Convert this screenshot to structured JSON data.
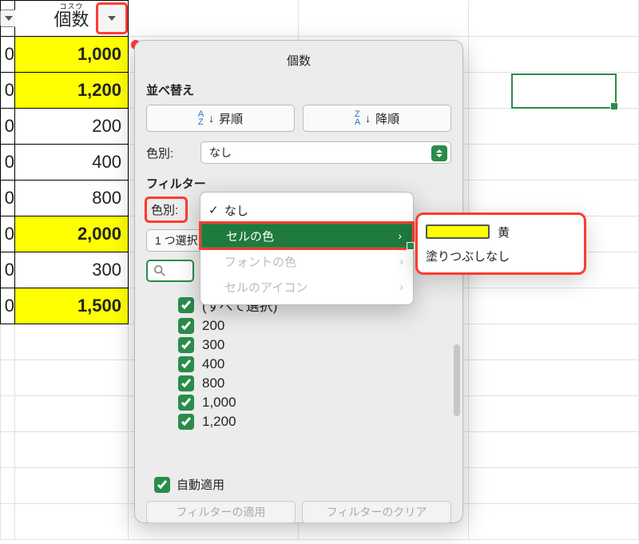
{
  "header": {
    "ruby": "コスウ",
    "label": "個数"
  },
  "rows": [
    {
      "v": "1,000",
      "hl": true
    },
    {
      "v": "1,200",
      "hl": true
    },
    {
      "v": "200",
      "hl": false
    },
    {
      "v": "400",
      "hl": false
    },
    {
      "v": "800",
      "hl": false
    },
    {
      "v": "2,000",
      "hl": true
    },
    {
      "v": "300",
      "hl": false
    },
    {
      "v": "1,500",
      "hl": true
    }
  ],
  "popover": {
    "title": "個数",
    "sort_label": "並べ替え",
    "asc_label": "昇順",
    "desc_label": "降順",
    "color_label": "色別:",
    "color_value": "なし",
    "filter_label": "フィルター",
    "filter_color_label": "色別:",
    "choose_one_label": "1 つ選択",
    "search_placeholder": "検索",
    "items": [
      "(すべて選択)",
      "200",
      "300",
      "400",
      "800",
      "1,000",
      "1,200"
    ],
    "autoapply_label": "自動適用",
    "apply_btn": "フィルターの適用",
    "clear_btn": "フィルターのクリア"
  },
  "ctx": {
    "none": "なし",
    "cell_color": "セルの色",
    "font_color": "フォントの色",
    "cell_icon": "セルのアイコン"
  },
  "submenu": {
    "yellow_label": "黄",
    "nofill_label": "塗りつぶしなし"
  }
}
